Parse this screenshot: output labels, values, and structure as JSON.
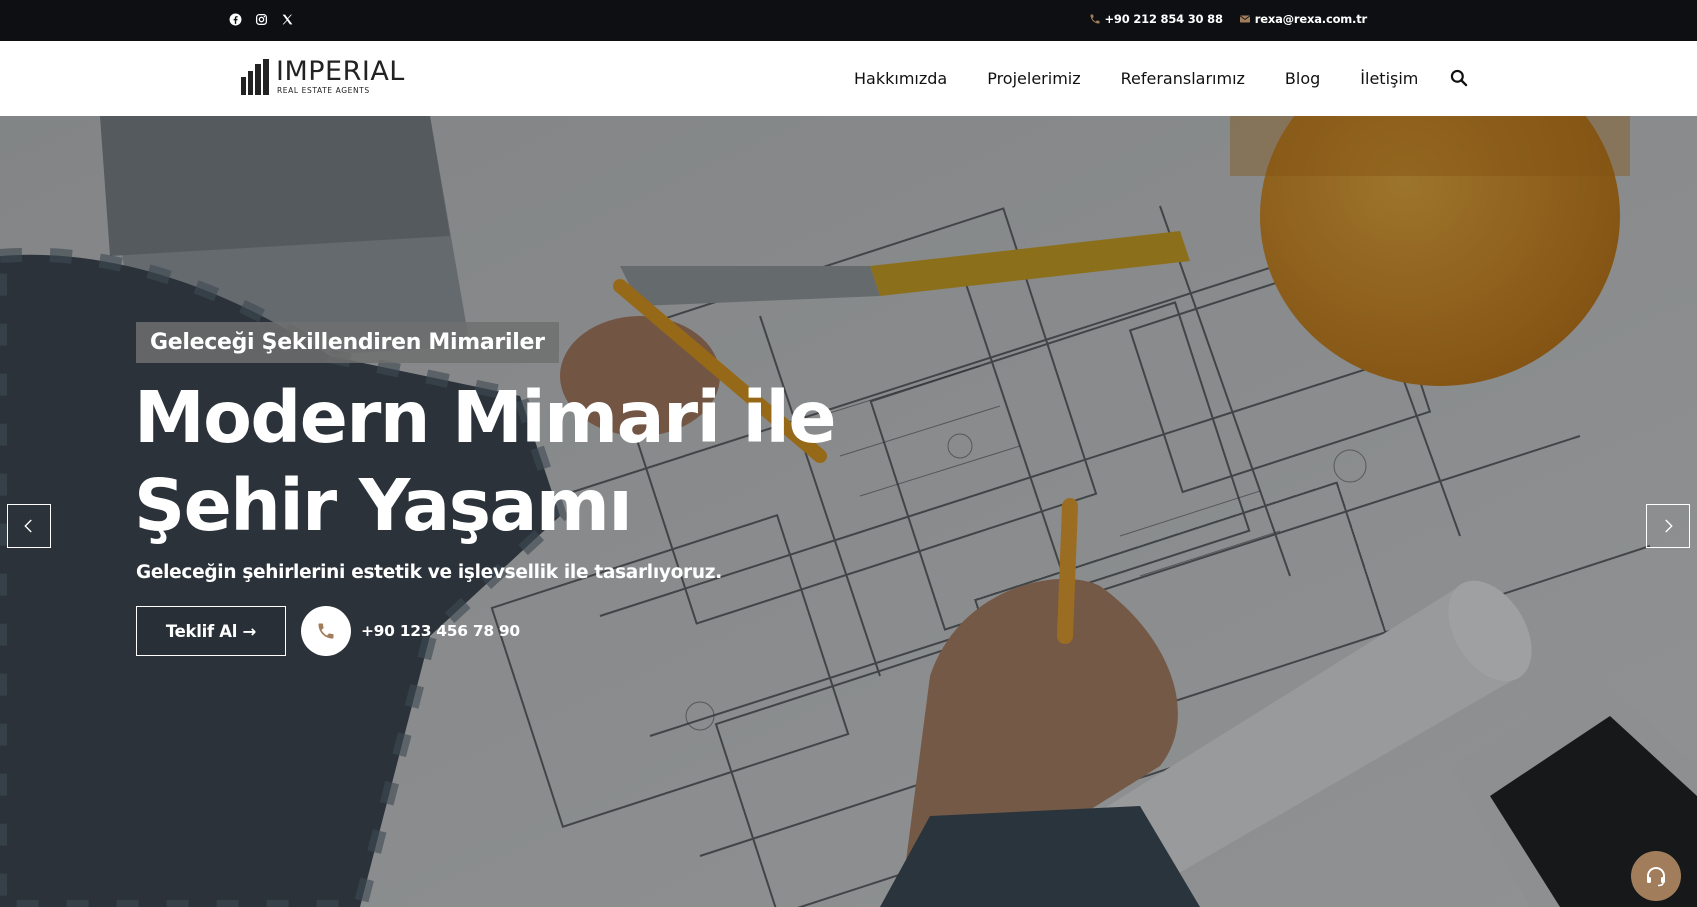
{
  "topbar": {
    "social": [
      "facebook-icon",
      "instagram-icon",
      "x-icon"
    ],
    "phone": "+90 212 854 30 88",
    "email": "rexa@rexa.com.tr"
  },
  "brand": {
    "name": "IMPERIAL",
    "tagline": "REAL ESTATE AGENTS"
  },
  "nav": {
    "items": [
      "Hakkımızda",
      "Projelerimiz",
      "Referanslarımız",
      "Blog",
      "İletişim"
    ]
  },
  "hero": {
    "kicker": "Geleceği Şekillendiren Mimariler",
    "title_line1": "Modern Mimari ile",
    "title_line2": "Şehir Yaşamı",
    "subtitle": "Geleceğin şehirlerini estetik ve işlevsellik ile tasarlıyoruz.",
    "cta_label": "Teklif Al →",
    "phone": "+90 123 456 78 90"
  },
  "colors": {
    "topbar_bg": "#0d0f12",
    "accent": "#a17d5b",
    "text_dark": "#111111"
  }
}
